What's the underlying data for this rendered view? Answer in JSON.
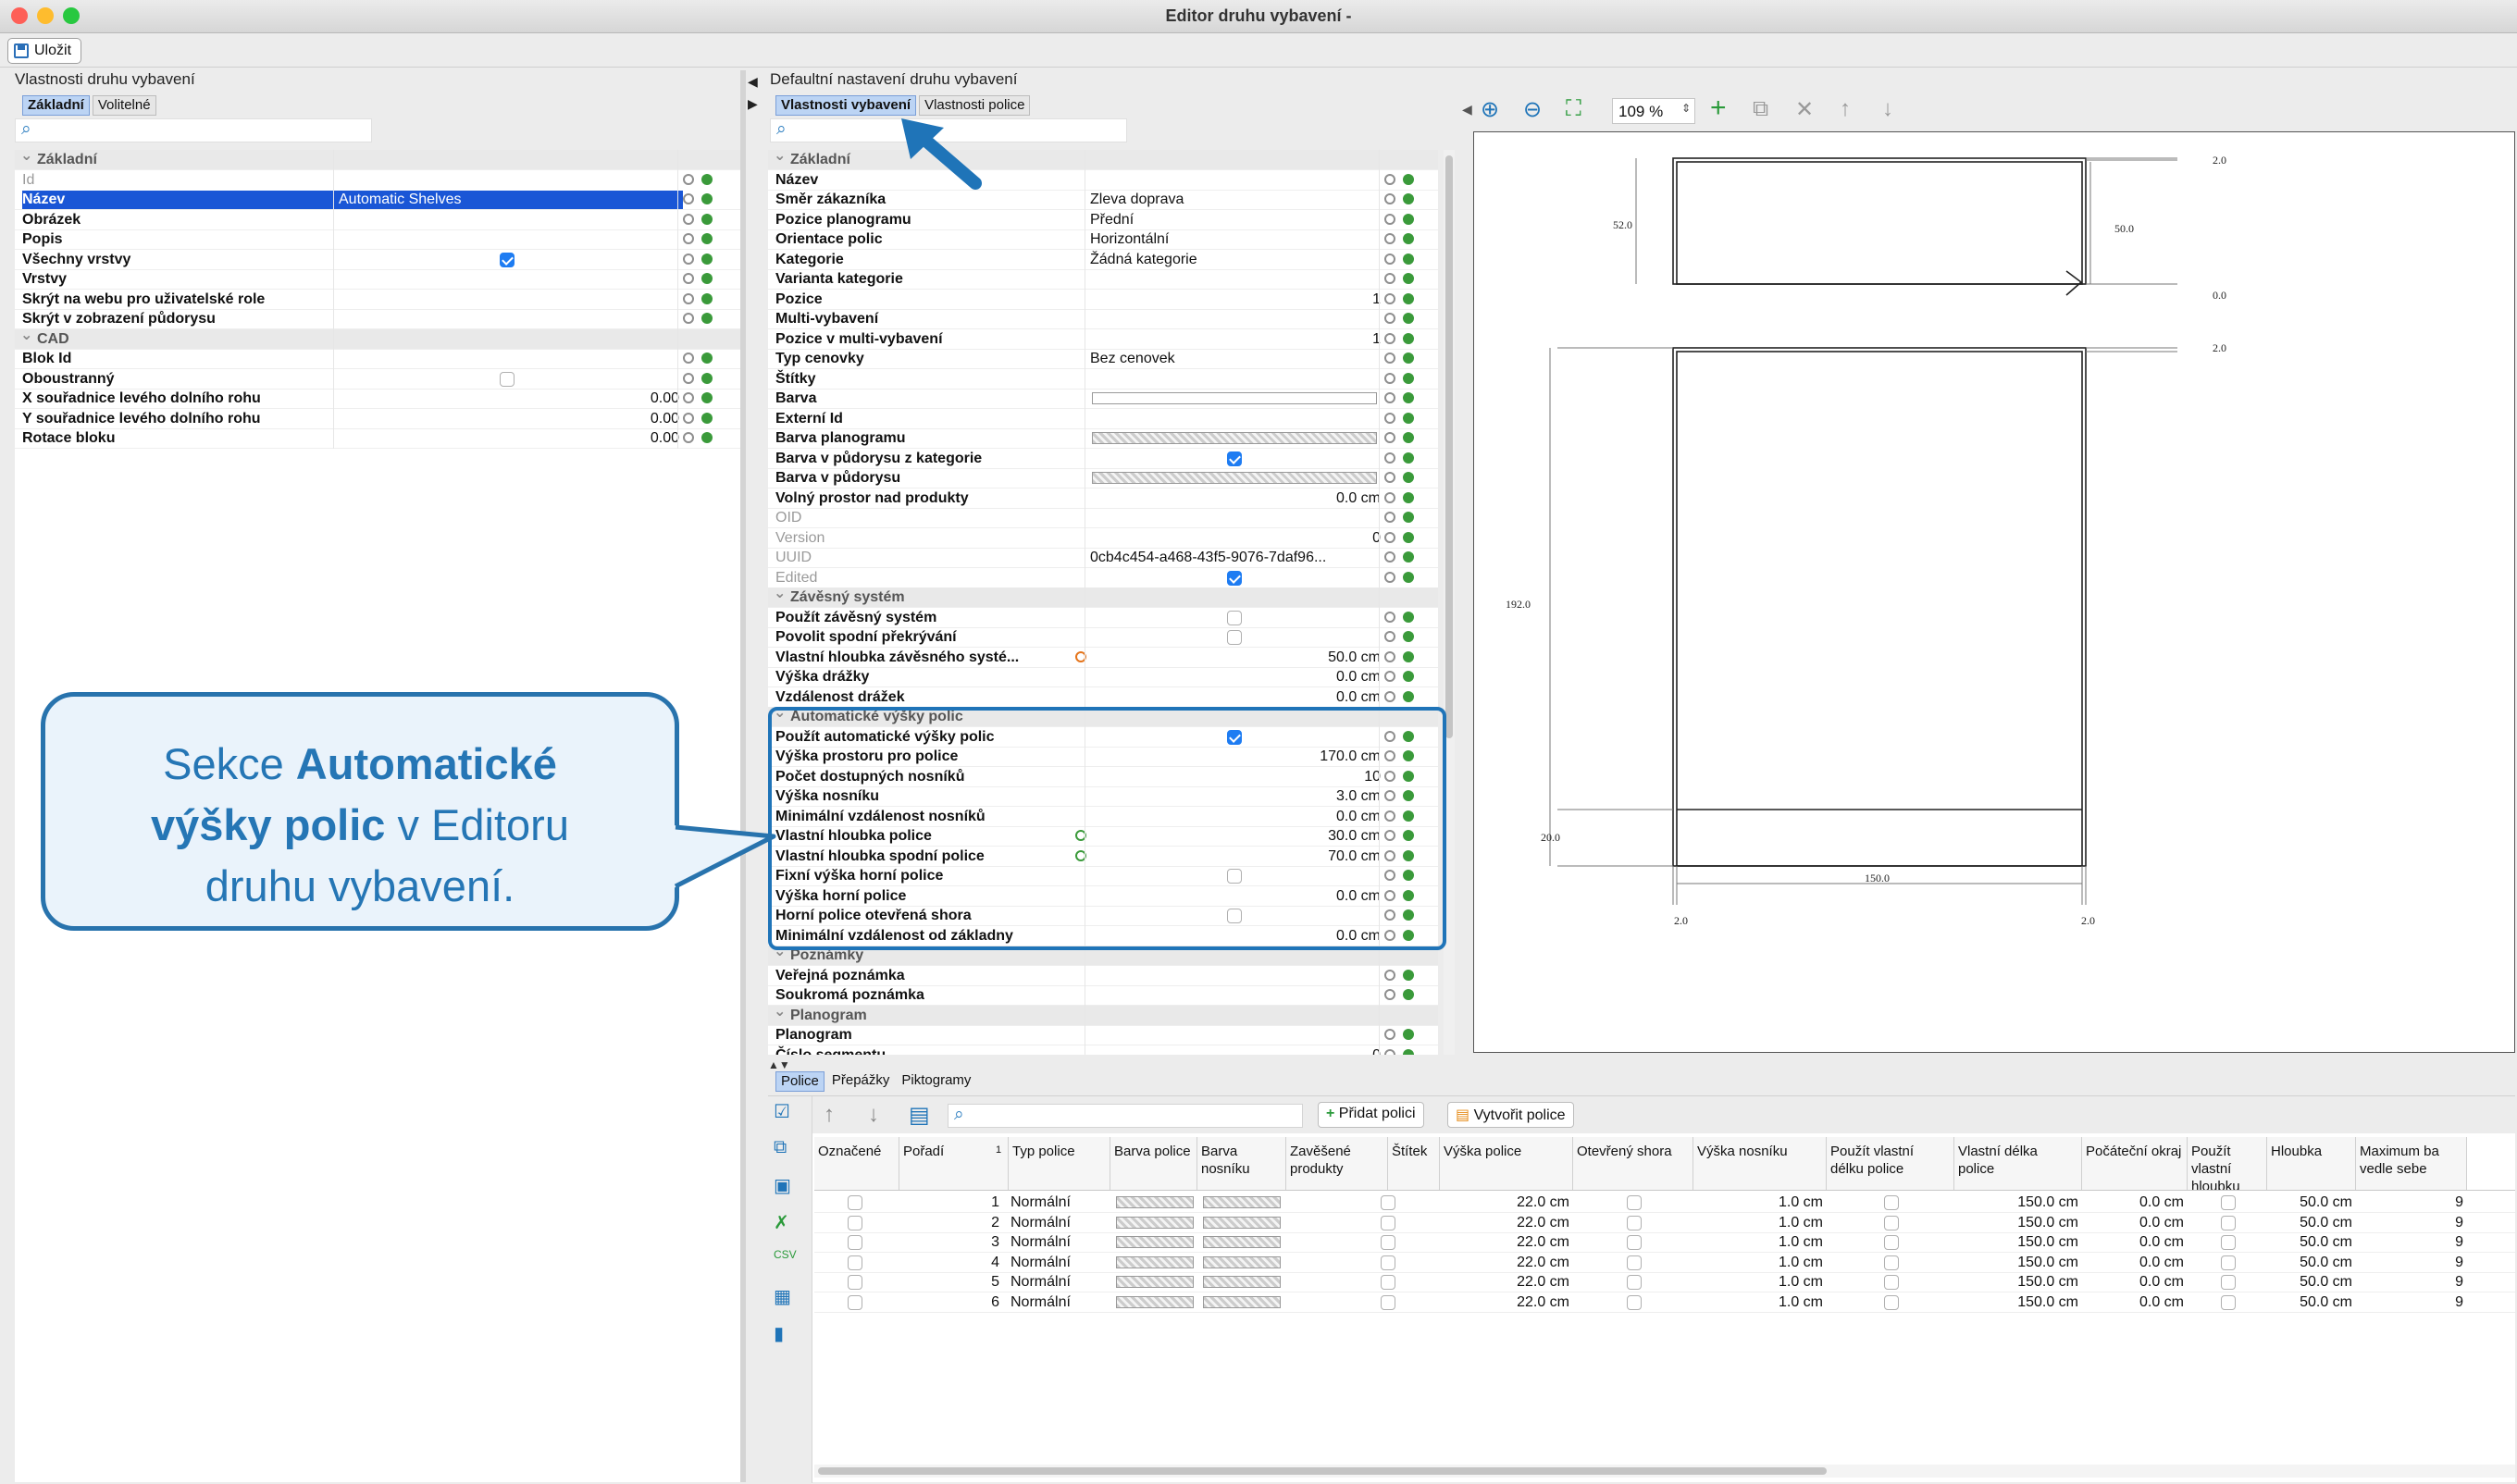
{
  "window": {
    "title": "Editor druhu vybavení -",
    "save_label": "Uložit"
  },
  "left": {
    "title": "Vlastnosti druhu vybavení",
    "tabs": [
      "Základní",
      "Volitelné"
    ],
    "rows": [
      {
        "kind": "sec",
        "label": "Základní"
      },
      {
        "label": "Id",
        "ro": true
      },
      {
        "label": "Název",
        "value": "Automatic Shelves",
        "selected": true
      },
      {
        "label": "Obrázek"
      },
      {
        "label": "Popis"
      },
      {
        "label": "Všechny vrstvy",
        "check": true
      },
      {
        "label": "Vrstvy"
      },
      {
        "label": "Skrýt na webu pro uživatelské role"
      },
      {
        "label": "Skrýt v zobrazení půdorysu"
      },
      {
        "kind": "sec",
        "label": "CAD"
      },
      {
        "label": "Blok Id"
      },
      {
        "label": "Oboustranný",
        "check": false
      },
      {
        "label": "X souřadnice levého dolního rohu",
        "num": "0.00"
      },
      {
        "label": "Y souřadnice levého dolního rohu",
        "num": "0.00"
      },
      {
        "label": "Rotace bloku",
        "num": "0.00"
      }
    ]
  },
  "middle": {
    "title": "Defaultní nastavení druhu vybavení",
    "tabs": [
      "Vlastnosti vybavení",
      "Vlastnosti police"
    ],
    "rows": [
      {
        "kind": "sec",
        "label": "Základní"
      },
      {
        "label": "Název"
      },
      {
        "label": "Směr zákazníka",
        "value": "Zleva doprava"
      },
      {
        "label": "Pozice planogramu",
        "value": "Přední"
      },
      {
        "label": "Orientace polic",
        "value": "Horizontální"
      },
      {
        "label": "Kategorie",
        "value": "Žádná kategorie"
      },
      {
        "label": "Varianta kategorie"
      },
      {
        "label": "Pozice",
        "num": "1"
      },
      {
        "label": "Multi-vybavení"
      },
      {
        "label": "Pozice v multi-vybavení",
        "num": "1"
      },
      {
        "label": "Typ cenovky",
        "value": "Bez cenovek"
      },
      {
        "label": "Štítky"
      },
      {
        "label": "Barva",
        "swatch": "white"
      },
      {
        "label": "Externí Id"
      },
      {
        "label": "Barva planogramu",
        "swatch": "pattern"
      },
      {
        "label": "Barva v půdorysu z kategorie",
        "check": true
      },
      {
        "label": "Barva v půdorysu",
        "swatch": "pattern"
      },
      {
        "label": "Volný prostor nad produkty",
        "num": "0.0 cm"
      },
      {
        "label": "OID",
        "ro": true
      },
      {
        "label": "Version",
        "ro": true,
        "num": "0"
      },
      {
        "label": "UUID",
        "ro": true,
        "value": "0cb4c454-a468-43f5-9076-7daf96..."
      },
      {
        "label": "Edited",
        "ro": true,
        "check": true
      },
      {
        "kind": "sec",
        "label": "Závěsný systém"
      },
      {
        "label": "Použít závěsný systém",
        "check": false
      },
      {
        "label": "Povolit spodní překrývání",
        "check": false
      },
      {
        "label": "Vlastní hloubka závěsného systé...",
        "num": "50.0 cm",
        "orange": true
      },
      {
        "label": "Výška drážky",
        "num": "0.0 cm"
      },
      {
        "label": "Vzdálenost drážek",
        "num": "0.0 cm"
      },
      {
        "kind": "sec",
        "label": "Automatické výšky polic"
      },
      {
        "label": "Použít automatické výšky polic",
        "check": true
      },
      {
        "label": "Výška prostoru pro police",
        "num": "170.0 cm"
      },
      {
        "label": "Počet dostupných nosníků",
        "num": "10"
      },
      {
        "label": "Výška nosníku",
        "num": "3.0 cm"
      },
      {
        "label": "Minimální vzdálenost nosníků",
        "num": "0.0 cm"
      },
      {
        "label": "Vlastní hloubka police",
        "num": "30.0 cm",
        "green": true
      },
      {
        "label": "Vlastní hloubka spodní police",
        "num": "70.0 cm",
        "green": true
      },
      {
        "label": "Fixní výška horní police",
        "check": false
      },
      {
        "label": "Výška horní police",
        "num": "0.0 cm"
      },
      {
        "label": "Horní police otevřená shora",
        "check": false
      },
      {
        "label": "Minimální vzdálenost od základny",
        "num": "0.0 cm"
      },
      {
        "kind": "sec",
        "label": "Poznámky"
      },
      {
        "label": "Veřejná poznámka"
      },
      {
        "label": "Soukromá poznámka"
      },
      {
        "kind": "sec",
        "label": "Planogram"
      },
      {
        "label": "Planogram"
      },
      {
        "label": "Číslo segmentu",
        "num": "0"
      }
    ]
  },
  "preview": {
    "zoom": "109 %",
    "dims": {
      "top_right": "2.0",
      "left_top": "52.0",
      "right_top": "50.0",
      "zero": "0.0",
      "top2": "2.0",
      "height": "192.0",
      "bottom": "20.0",
      "width": "150.0",
      "bl": "2.0",
      "br": "2.0"
    }
  },
  "bottom": {
    "tabs": [
      "Police",
      "Přepážky",
      "Piktogramy"
    ],
    "add_label": "Přidat polici",
    "create_label": "Vytvořit police",
    "columns": [
      "Označené",
      "Pořadí",
      "Typ police",
      "Barva police",
      "Barva nosníku",
      "Zavěšené produkty",
      "Štítek",
      "Výška police",
      "Otevřený shora",
      "Výška nosníku",
      "Použít vlastní délku police",
      "Vlastní délka police",
      "Počáteční okraj",
      "Použít vlastní hloubku",
      "Hloubka",
      "Maximum ba vedle sebe"
    ],
    "sort_mark": "1",
    "rows": [
      {
        "order": "1",
        "type": "Normální",
        "height": "22.0 cm",
        "beam": "1.0 cm",
        "len": "150.0 cm",
        "margin": "0.0 cm",
        "depth": "50.0 cm",
        "max": "9"
      },
      {
        "order": "2",
        "type": "Normální",
        "height": "22.0 cm",
        "beam": "1.0 cm",
        "len": "150.0 cm",
        "margin": "0.0 cm",
        "depth": "50.0 cm",
        "max": "9"
      },
      {
        "order": "3",
        "type": "Normální",
        "height": "22.0 cm",
        "beam": "1.0 cm",
        "len": "150.0 cm",
        "margin": "0.0 cm",
        "depth": "50.0 cm",
        "max": "9"
      },
      {
        "order": "4",
        "type": "Normální",
        "height": "22.0 cm",
        "beam": "1.0 cm",
        "len": "150.0 cm",
        "margin": "0.0 cm",
        "depth": "50.0 cm",
        "max": "9"
      },
      {
        "order": "5",
        "type": "Normální",
        "height": "22.0 cm",
        "beam": "1.0 cm",
        "len": "150.0 cm",
        "margin": "0.0 cm",
        "depth": "50.0 cm",
        "max": "9"
      },
      {
        "order": "6",
        "type": "Normální",
        "height": "22.0 cm",
        "beam": "1.0 cm",
        "len": "150.0 cm",
        "margin": "0.0 cm",
        "depth": "50.0 cm",
        "max": "9"
      }
    ]
  },
  "callout": {
    "pre": "Sekce ",
    "bold1": "Automatické",
    "bold2": "výšky polic",
    "mid": " v Editoru",
    "post": "druhu vybavení."
  },
  "colors": {
    "accent": "#1f74b8",
    "selection": "#1a56d6",
    "check": "#1e7cf2"
  }
}
